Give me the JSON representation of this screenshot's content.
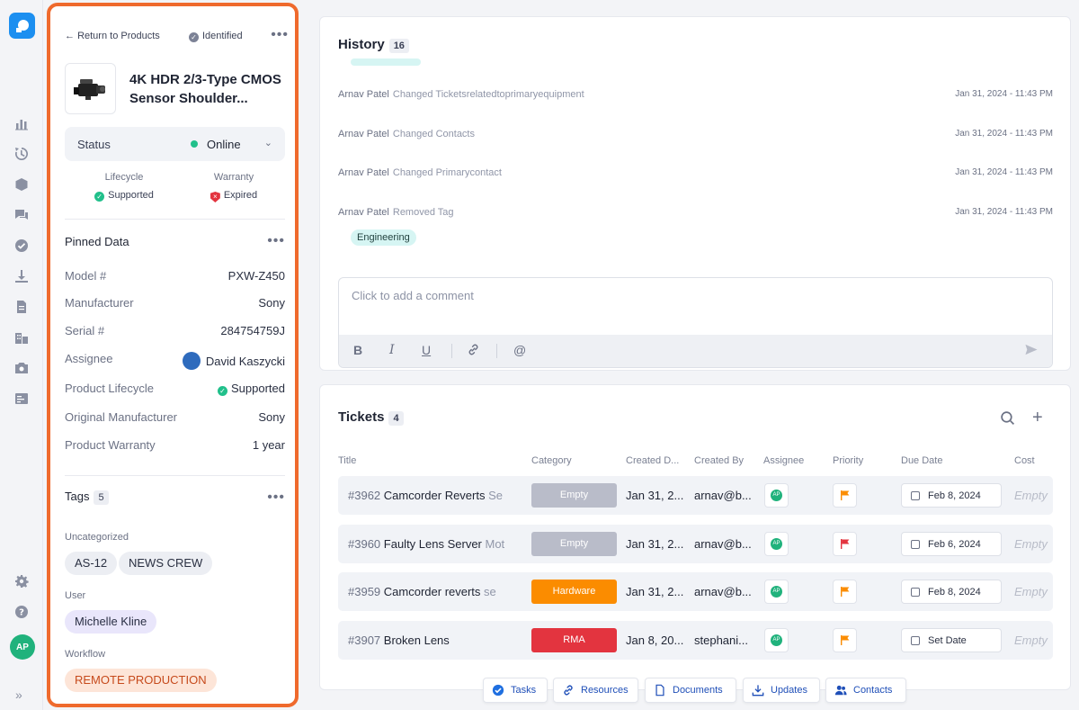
{
  "nav": {
    "user_initials": "AP",
    "items": [
      "analytics-icon",
      "history-icon",
      "box-icon",
      "chat-icon",
      "check-icon",
      "download-icon",
      "document-icon",
      "building-icon",
      "camera-icon",
      "form-icon"
    ],
    "bottom": [
      "gear-icon",
      "help-icon"
    ],
    "expand_glyph": "»"
  },
  "product": {
    "back_label": "Return to Products",
    "identified_label": "Identified",
    "more_glyph": "•••",
    "title_line1": "4K HDR 2/3-Type CMOS",
    "title_line2": "Sensor Shoulder...",
    "status_label": "Status",
    "status_value": "Online",
    "status_color": "#21c08b",
    "lifecycle_label": "Lifecycle",
    "lifecycle_value": "Supported",
    "warranty_label": "Warranty",
    "warranty_value": "Expired"
  },
  "pinned": {
    "title": "Pinned Data",
    "fields": [
      {
        "key": "Model #",
        "value": "PXW-Z450"
      },
      {
        "key": "Manufacturer",
        "value": "Sony"
      },
      {
        "key": "Serial #",
        "value": "284754759J"
      },
      {
        "key": "Assignee",
        "value": "David Kaszycki"
      },
      {
        "key": "Product Lifecycle",
        "value": "Supported"
      },
      {
        "key": "Original Manufacturer",
        "value": "Sony"
      },
      {
        "key": "Product Warranty",
        "value": "1 year"
      }
    ]
  },
  "tags": {
    "title": "Tags",
    "count": "5",
    "groups": [
      {
        "name": "Uncategorized",
        "items": [
          "AS-12",
          "NEWS CREW"
        ]
      },
      {
        "name": "User",
        "items": [
          "Michelle Kline"
        ]
      },
      {
        "name": "Workflow",
        "items": [
          "REMOTE PRODUCTION"
        ]
      }
    ]
  },
  "history": {
    "title": "History",
    "count": "16",
    "rows": [
      {
        "who": "Arnav Patel",
        "what": "Changed Ticketsrelatedtoprimaryequipment",
        "when": "Jan 31, 2024 - 11:43 PM"
      },
      {
        "who": "Arnav Patel",
        "what": "Changed Contacts",
        "when": "Jan 31, 2024 - 11:43 PM"
      },
      {
        "who": "Arnav Patel",
        "what": "Changed Primarycontact",
        "when": "Jan 31, 2024 - 11:43 PM"
      },
      {
        "who": "Arnav Patel",
        "what": "Removed Tag",
        "when": "Jan 31, 2024 - 11:43 PM"
      }
    ],
    "removed_tag": "Engineering",
    "comment_placeholder": "Click to add a comment"
  },
  "tickets": {
    "title": "Tickets",
    "count": "4",
    "columns": [
      "Title",
      "Category",
      "Created D...",
      "Created By",
      "Assignee",
      "Priority",
      "Due Date",
      "Cost"
    ],
    "rows": [
      {
        "num": "#3962",
        "title": "Camcorder Reverts",
        "title_rest": " Se",
        "category": "Empty",
        "cat_class": "empty",
        "created": "Jan 31, 2...",
        "by": "arnav@b...",
        "assignee": "AP",
        "priority_color": "#fb8c00",
        "due": "Feb 8, 2024",
        "cost": "Empty"
      },
      {
        "num": "#3960",
        "title": "Faulty Lens Server",
        "title_rest": " Mot",
        "category": "Empty",
        "cat_class": "empty",
        "created": "Jan 31, 2...",
        "by": "arnav@b...",
        "assignee": "AP",
        "priority_color": "#e3343f",
        "due": "Feb 6, 2024",
        "cost": "Empty"
      },
      {
        "num": "#3959",
        "title": "Camcorder reverts",
        "title_rest": " se",
        "category": "Hardware",
        "cat_class": "hw",
        "created": "Jan 31, 2...",
        "by": "arnav@b...",
        "assignee": "AP",
        "priority_color": "#fb8c00",
        "due": "Feb 8, 2024",
        "cost": "Empty"
      },
      {
        "num": "#3907",
        "title": "Broken Lens",
        "title_rest": "",
        "category": "RMA",
        "cat_class": "rma",
        "created": "Jan 8, 20...",
        "by": "stephani...",
        "assignee": "AP",
        "priority_color": "#fb8c00",
        "due": "Set Date",
        "cost": "Empty"
      }
    ]
  },
  "dock": [
    {
      "label": "Tasks",
      "icon": "check-circle-icon"
    },
    {
      "label": "Resources",
      "icon": "link-icon"
    },
    {
      "label": "Documents",
      "icon": "document-icon"
    },
    {
      "label": "Updates",
      "icon": "download-icon"
    },
    {
      "label": "Contacts",
      "icon": "contacts-icon"
    }
  ],
  "colors": {
    "accent": "#ef6a2d",
    "brand": "#1c8ff0",
    "link": "#1f4fb8"
  }
}
